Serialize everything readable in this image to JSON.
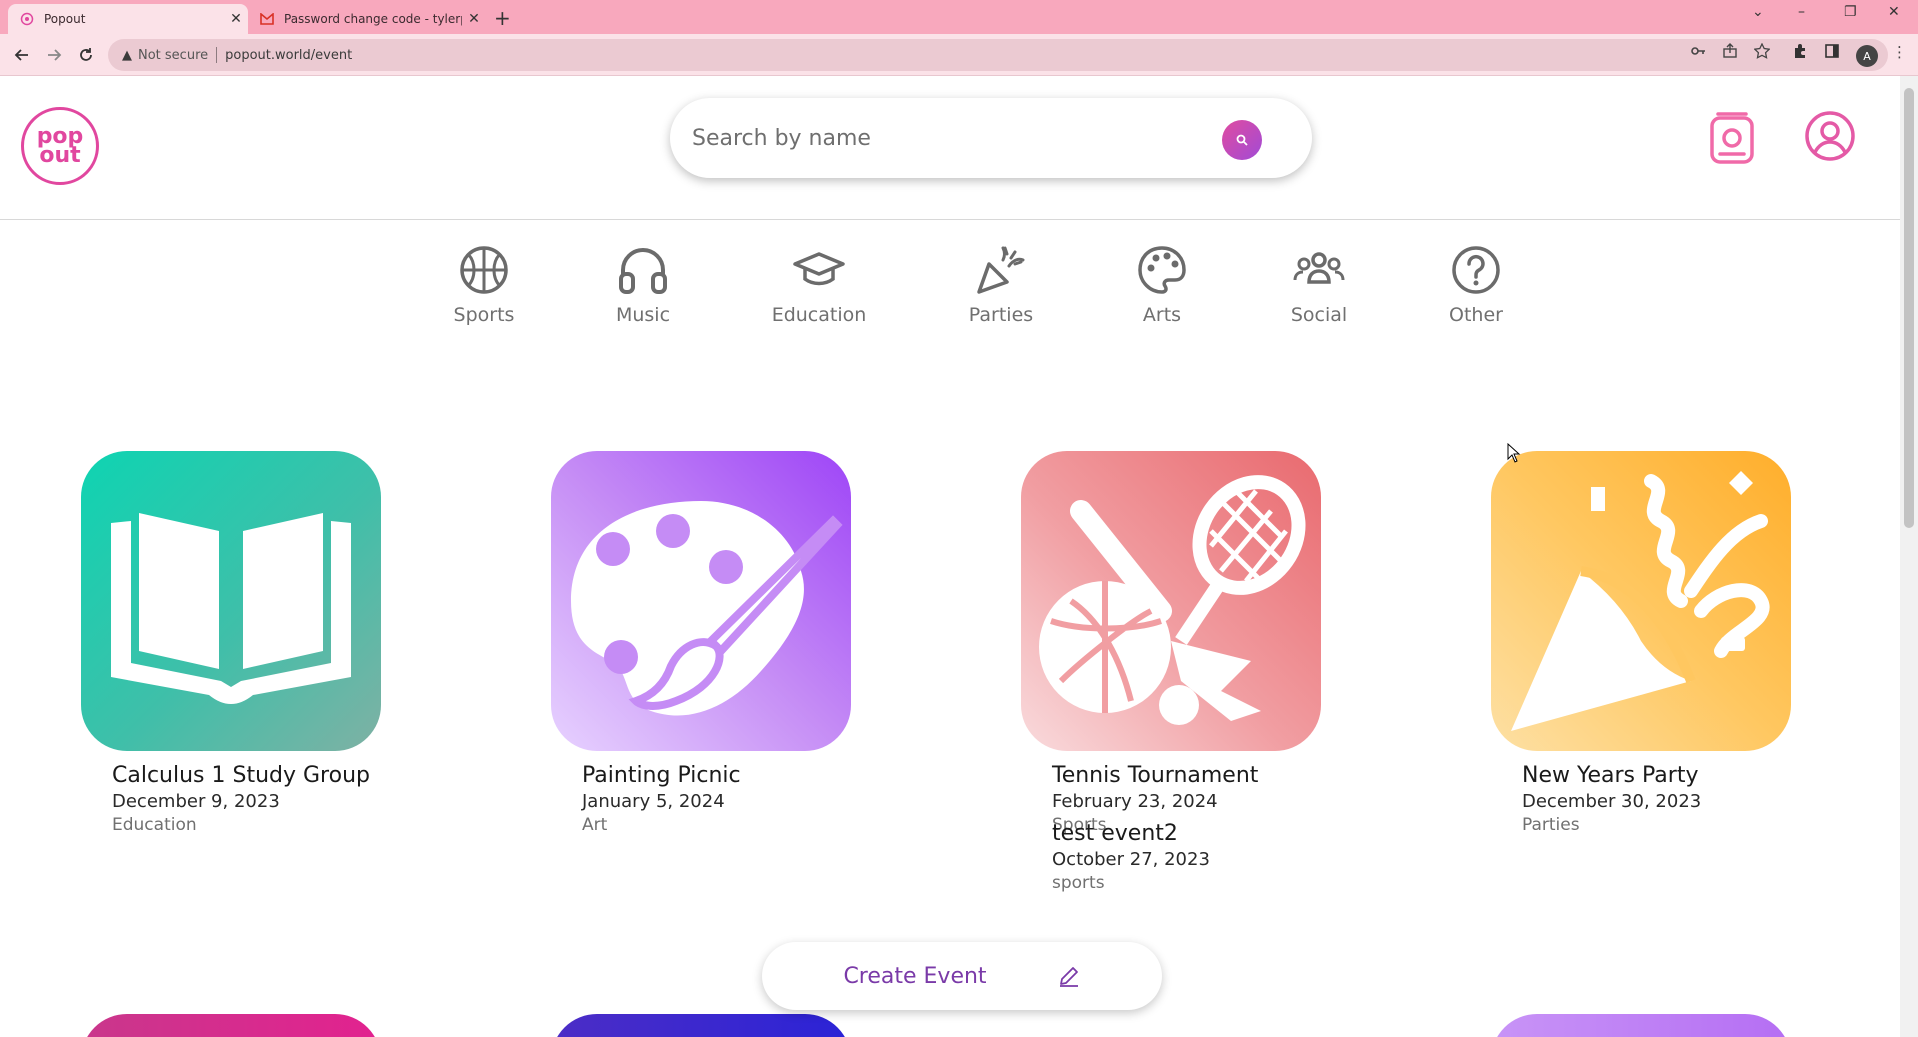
{
  "browser": {
    "tabs": [
      {
        "title": "Popout",
        "active": true
      },
      {
        "title": "Password change code - tylerph",
        "active": false
      }
    ],
    "new_tab": "+",
    "window_controls": {
      "minimize": "–",
      "restore": "❐",
      "close": "✕",
      "tab_search": "⌄"
    },
    "address": {
      "security_label": "Not secure",
      "url": "popout.world/event"
    },
    "profile_initial": "A"
  },
  "header": {
    "logo": {
      "line1": "pop",
      "line2": "out"
    },
    "search": {
      "placeholder": "Search by name",
      "value": ""
    }
  },
  "categories": [
    {
      "label": "Sports",
      "icon": "basketball-icon"
    },
    {
      "label": "Music",
      "icon": "headphones-icon"
    },
    {
      "label": "Education",
      "icon": "graduation-cap-icon"
    },
    {
      "label": "Parties",
      "icon": "party-popper-icon"
    },
    {
      "label": "Arts",
      "icon": "palette-icon"
    },
    {
      "label": "Social",
      "icon": "users-icon"
    },
    {
      "label": "Other",
      "icon": "question-icon"
    }
  ],
  "events": [
    {
      "name": "Calculus 1 Study Group",
      "date": "December 9, 2023",
      "category": "Education"
    },
    {
      "name": "Painting Picnic",
      "date": "January 5, 2024",
      "category": "Art"
    },
    {
      "name": "Tennis Tournament",
      "date": "February 23, 2024",
      "category": "Sports"
    },
    {
      "name": "New Years Party",
      "date": "December 30, 2023",
      "category": "Parties"
    }
  ],
  "overlap_event": {
    "name": "test event2",
    "date": "October 27, 2023",
    "category": "sports"
  },
  "create_event": {
    "label": "Create Event"
  },
  "colors": {
    "brand_pink": "#e1479f",
    "accent_purple": "#7a3aa8",
    "tab_bar": "#f8a8bd"
  }
}
